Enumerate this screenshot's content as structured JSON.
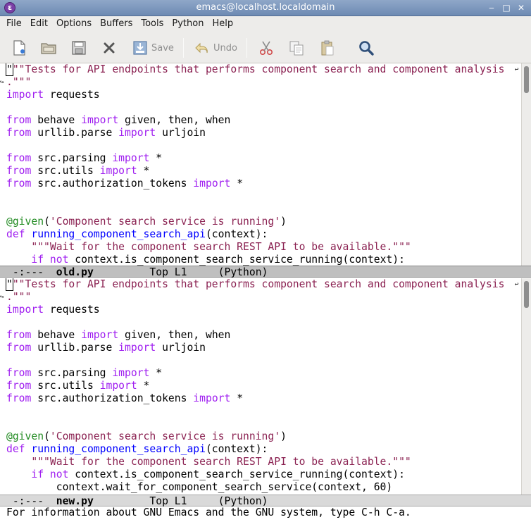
{
  "window": {
    "title": "emacs@localhost.localdomain",
    "minimize_glyph": "‒",
    "maximize_glyph": "□",
    "close_glyph": "✕"
  },
  "menubar": [
    "File",
    "Edit",
    "Options",
    "Buffers",
    "Tools",
    "Python",
    "Help"
  ],
  "toolbar": {
    "save_label": "Save",
    "undo_label": "Undo",
    "icons": [
      "new-file-icon",
      "open-folder-icon",
      "save-disk-icon",
      "close-x-icon",
      "save-icon",
      "undo-icon",
      "cut-icon",
      "copy-icon",
      "paste-icon",
      "search-icon"
    ]
  },
  "top_window": {
    "lines": [
      {
        "type": "doc1",
        "a": "\"",
        "b": "\"\"Tests for API endpoints that performs component search and component analysis"
      },
      {
        "type": "doc2",
        "a": ".\"\"\""
      },
      {
        "type": "imp",
        "a": "import",
        "b": " requests"
      },
      {
        "type": "blank"
      },
      {
        "type": "from",
        "a": "from",
        "b": " behave ",
        "c": "import",
        "d": " given, then, when"
      },
      {
        "type": "from",
        "a": "from",
        "b": " urllib.parse ",
        "c": "import",
        "d": " urljoin"
      },
      {
        "type": "blank"
      },
      {
        "type": "from",
        "a": "from",
        "b": " src.parsing ",
        "c": "import",
        "d": " *"
      },
      {
        "type": "from",
        "a": "from",
        "b": " src.utils ",
        "c": "import",
        "d": " *"
      },
      {
        "type": "from",
        "a": "from",
        "b": " src.authorization_tokens ",
        "c": "import",
        "d": " *"
      },
      {
        "type": "blank"
      },
      {
        "type": "blank"
      },
      {
        "type": "deco",
        "a": "@given",
        "b": "(",
        "c": "'Component search service is running'",
        "d": ")"
      },
      {
        "type": "def",
        "a": "def",
        "b": " ",
        "c": "running_component_search_api",
        "d": "(context):"
      },
      {
        "type": "docstr",
        "a": "    ",
        "b": "\"\"\"Wait for the component search REST API to be available.\"\"\""
      },
      {
        "type": "ifnot",
        "a": "    ",
        "b": "if",
        "c": " ",
        "d": "not",
        "e": " context.is_component_search_service_running(context):"
      }
    ],
    "modeline": {
      "status": " -:---  ",
      "buffer": "old.py",
      "position": "         Top L1     (Python)"
    }
  },
  "bottom_window": {
    "lines": [
      {
        "type": "doc1",
        "a": "\"",
        "b": "\"\"Tests for API endpoints that performs component search and component analysis"
      },
      {
        "type": "doc2",
        "a": ".\"\"\""
      },
      {
        "type": "imp",
        "a": "import",
        "b": " requests"
      },
      {
        "type": "blank"
      },
      {
        "type": "from",
        "a": "from",
        "b": " behave ",
        "c": "import",
        "d": " given, then, when"
      },
      {
        "type": "from",
        "a": "from",
        "b": " urllib.parse ",
        "c": "import",
        "d": " urljoin"
      },
      {
        "type": "blank"
      },
      {
        "type": "from",
        "a": "from",
        "b": " src.parsing ",
        "c": "import",
        "d": " *"
      },
      {
        "type": "from",
        "a": "from",
        "b": " src.utils ",
        "c": "import",
        "d": " *"
      },
      {
        "type": "from",
        "a": "from",
        "b": " src.authorization_tokens ",
        "c": "import",
        "d": " *"
      },
      {
        "type": "blank"
      },
      {
        "type": "blank"
      },
      {
        "type": "deco",
        "a": "@given",
        "b": "(",
        "c": "'Component search service is running'",
        "d": ")"
      },
      {
        "type": "def",
        "a": "def",
        "b": " ",
        "c": "running_component_search_api",
        "d": "(context):"
      },
      {
        "type": "docstr",
        "a": "    ",
        "b": "\"\"\"Wait for the component search REST API to be available.\"\"\""
      },
      {
        "type": "ifnot",
        "a": "    ",
        "b": "if",
        "c": " ",
        "d": "not",
        "e": " context.is_component_search_service_running(context):"
      },
      {
        "type": "plain",
        "a": "        context.wait_for_component_search_service(context, 60)"
      }
    ],
    "modeline": {
      "status": " -:---  ",
      "buffer": "new.py",
      "position": "         Top L1     (Python)"
    }
  },
  "echo_area": "For information about GNU Emacs and the GNU system, type C-h C-a.",
  "colors": {
    "keyword": "#a020f0",
    "string": "#8b2252",
    "function": "#0000ff",
    "decorator": "#228b22"
  }
}
